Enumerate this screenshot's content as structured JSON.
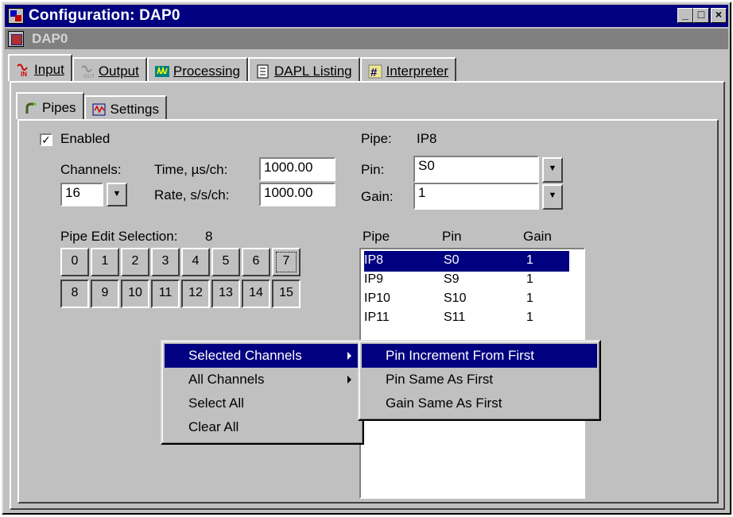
{
  "window": {
    "title": "Configuration: DAP0",
    "subtitle": "DAP0",
    "controls": {
      "minimize": "_",
      "maximize": "□",
      "close": "×"
    }
  },
  "main_tabs": [
    {
      "label": "Input",
      "icon": "input-signal-icon"
    },
    {
      "label": "Output",
      "icon": "output-signal-icon"
    },
    {
      "label": "Processing",
      "icon": "processing-wave-icon"
    },
    {
      "label": "DAPL Listing",
      "icon": "listing-icon"
    },
    {
      "label": "Interpreter",
      "icon": "interpreter-icon"
    }
  ],
  "sub_tabs": [
    {
      "label": "Pipes",
      "icon": "pipe-icon"
    },
    {
      "label": "Settings",
      "icon": "settings-signal-icon"
    }
  ],
  "enabled": {
    "label": "Enabled",
    "checked": true,
    "mark": "✓"
  },
  "channels": {
    "label": "Channels:",
    "value": "16"
  },
  "time": {
    "label": "Time, µs/ch:",
    "value": "1000.00"
  },
  "rate": {
    "label": "Rate, s/s/ch:",
    "value": "1000.00"
  },
  "pipe": {
    "label": "Pipe:",
    "value": "IP8"
  },
  "pin": {
    "label": "Pin:",
    "value": "S0"
  },
  "gain": {
    "label": "Gain:",
    "value": "1"
  },
  "pipe_edit": {
    "label": "Pipe Edit Selection:",
    "value": "8"
  },
  "channel_buttons_row1": [
    "0",
    "1",
    "2",
    "3",
    "4",
    "5",
    "6",
    "7"
  ],
  "channel_buttons_row2": [
    "8",
    "9",
    "10",
    "11",
    "12",
    "13",
    "14",
    "15"
  ],
  "pipe_list": {
    "headers": [
      "Pipe",
      "Pin",
      "Gain"
    ],
    "rows": [
      {
        "pipe": "IP8",
        "pin": "S0",
        "gain": "1"
      },
      {
        "pipe": "IP9",
        "pin": "S9",
        "gain": "1"
      },
      {
        "pipe": "IP10",
        "pin": "S10",
        "gain": "1"
      },
      {
        "pipe": "IP11",
        "pin": "S11",
        "gain": "1"
      }
    ],
    "selected_index": 0
  },
  "context_menu": {
    "items": [
      "Selected Channels",
      "All Channels",
      "Select All",
      "Clear All"
    ],
    "highlighted": "Selected Channels"
  },
  "submenu": {
    "items": [
      "Pin Increment From First",
      "Pin Same As First",
      "Gain Same As First"
    ],
    "highlighted": "Pin Increment From First"
  },
  "colors": {
    "titlebar": "#000080",
    "face": "#c0c0c0",
    "selection": "#000080",
    "subtitle_bar": "#808080"
  }
}
